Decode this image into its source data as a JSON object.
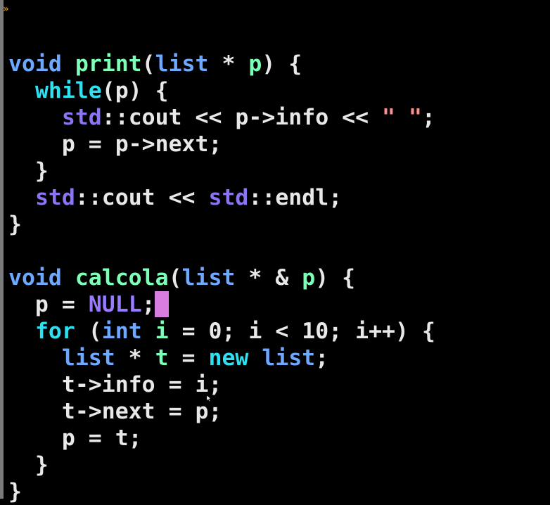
{
  "editor": {
    "fold_marker": "»",
    "lines": [
      [
        {
          "text": "void",
          "kind": "type"
        },
        {
          "text": " ",
          "kind": "plain"
        },
        {
          "text": "print",
          "kind": "fn"
        },
        {
          "text": "(",
          "kind": "plain"
        },
        {
          "text": "list",
          "kind": "type"
        },
        {
          "text": " * ",
          "kind": "plain"
        },
        {
          "text": "p",
          "kind": "var"
        },
        {
          "text": ") {",
          "kind": "plain"
        }
      ],
      [
        {
          "text": "  ",
          "kind": "plain"
        },
        {
          "text": "while",
          "kind": "kw"
        },
        {
          "text": "(p) {",
          "kind": "plain"
        }
      ],
      [
        {
          "text": "    ",
          "kind": "plain"
        },
        {
          "text": "std",
          "kind": "ns"
        },
        {
          "text": "::cout << p->info << ",
          "kind": "plain"
        },
        {
          "text": "\" \"",
          "kind": "str"
        },
        {
          "text": ";",
          "kind": "plain"
        }
      ],
      [
        {
          "text": "    p = p->next;",
          "kind": "plain"
        }
      ],
      [
        {
          "text": "  }",
          "kind": "plain"
        }
      ],
      [
        {
          "text": "  ",
          "kind": "plain"
        },
        {
          "text": "std",
          "kind": "ns"
        },
        {
          "text": "::cout << ",
          "kind": "plain"
        },
        {
          "text": "std",
          "kind": "ns"
        },
        {
          "text": "::endl;",
          "kind": "plain"
        }
      ],
      [
        {
          "text": "}",
          "kind": "plain"
        }
      ],
      [
        {
          "text": "",
          "kind": "plain"
        }
      ],
      [
        {
          "text": "void",
          "kind": "type"
        },
        {
          "text": " ",
          "kind": "plain"
        },
        {
          "text": "calcola",
          "kind": "fn"
        },
        {
          "text": "(",
          "kind": "plain"
        },
        {
          "text": "list",
          "kind": "type"
        },
        {
          "text": " * & ",
          "kind": "plain"
        },
        {
          "text": "p",
          "kind": "var"
        },
        {
          "text": ") {",
          "kind": "plain"
        }
      ],
      [
        {
          "text": "  p = ",
          "kind": "plain"
        },
        {
          "text": "NULL",
          "kind": "const"
        },
        {
          "text": ";",
          "kind": "plain"
        }
      ],
      [
        {
          "text": "  ",
          "kind": "plain"
        },
        {
          "text": "for",
          "kind": "kw"
        },
        {
          "text": " (",
          "kind": "plain"
        },
        {
          "text": "int",
          "kind": "type"
        },
        {
          "text": " ",
          "kind": "plain"
        },
        {
          "text": "i",
          "kind": "var"
        },
        {
          "text": " = 0; i < 10; i++) {",
          "kind": "plain"
        }
      ],
      [
        {
          "text": "    ",
          "kind": "plain"
        },
        {
          "text": "list",
          "kind": "type"
        },
        {
          "text": " * ",
          "kind": "plain"
        },
        {
          "text": "t",
          "kind": "var"
        },
        {
          "text": " = ",
          "kind": "plain"
        },
        {
          "text": "new",
          "kind": "kw"
        },
        {
          "text": " ",
          "kind": "plain"
        },
        {
          "text": "list",
          "kind": "type"
        },
        {
          "text": ";",
          "kind": "plain"
        }
      ],
      [
        {
          "text": "    t->info = i;",
          "kind": "plain"
        }
      ],
      [
        {
          "text": "    t->next = p;",
          "kind": "plain"
        }
      ],
      [
        {
          "text": "    p = t;",
          "kind": "plain"
        }
      ],
      [
        {
          "text": "  }",
          "kind": "plain"
        }
      ],
      [
        {
          "text": "}",
          "kind": "plain"
        }
      ]
    ]
  },
  "colors": {
    "background": "#000000",
    "type": "#6ea9ff",
    "function": "#7effb8",
    "keyword": "#2fe0f0",
    "namespace": "#8c74f5",
    "constant": "#9a7bff",
    "string": "#ff8f8f",
    "plain": "#e8e8e8",
    "cursor": "#d77ee0",
    "gutter": "#7a7a7a"
  },
  "icons": {
    "fold_marker": "fold-marker-icon",
    "cursor": "text-cursor",
    "mouse": "mouse-pointer-icon"
  }
}
